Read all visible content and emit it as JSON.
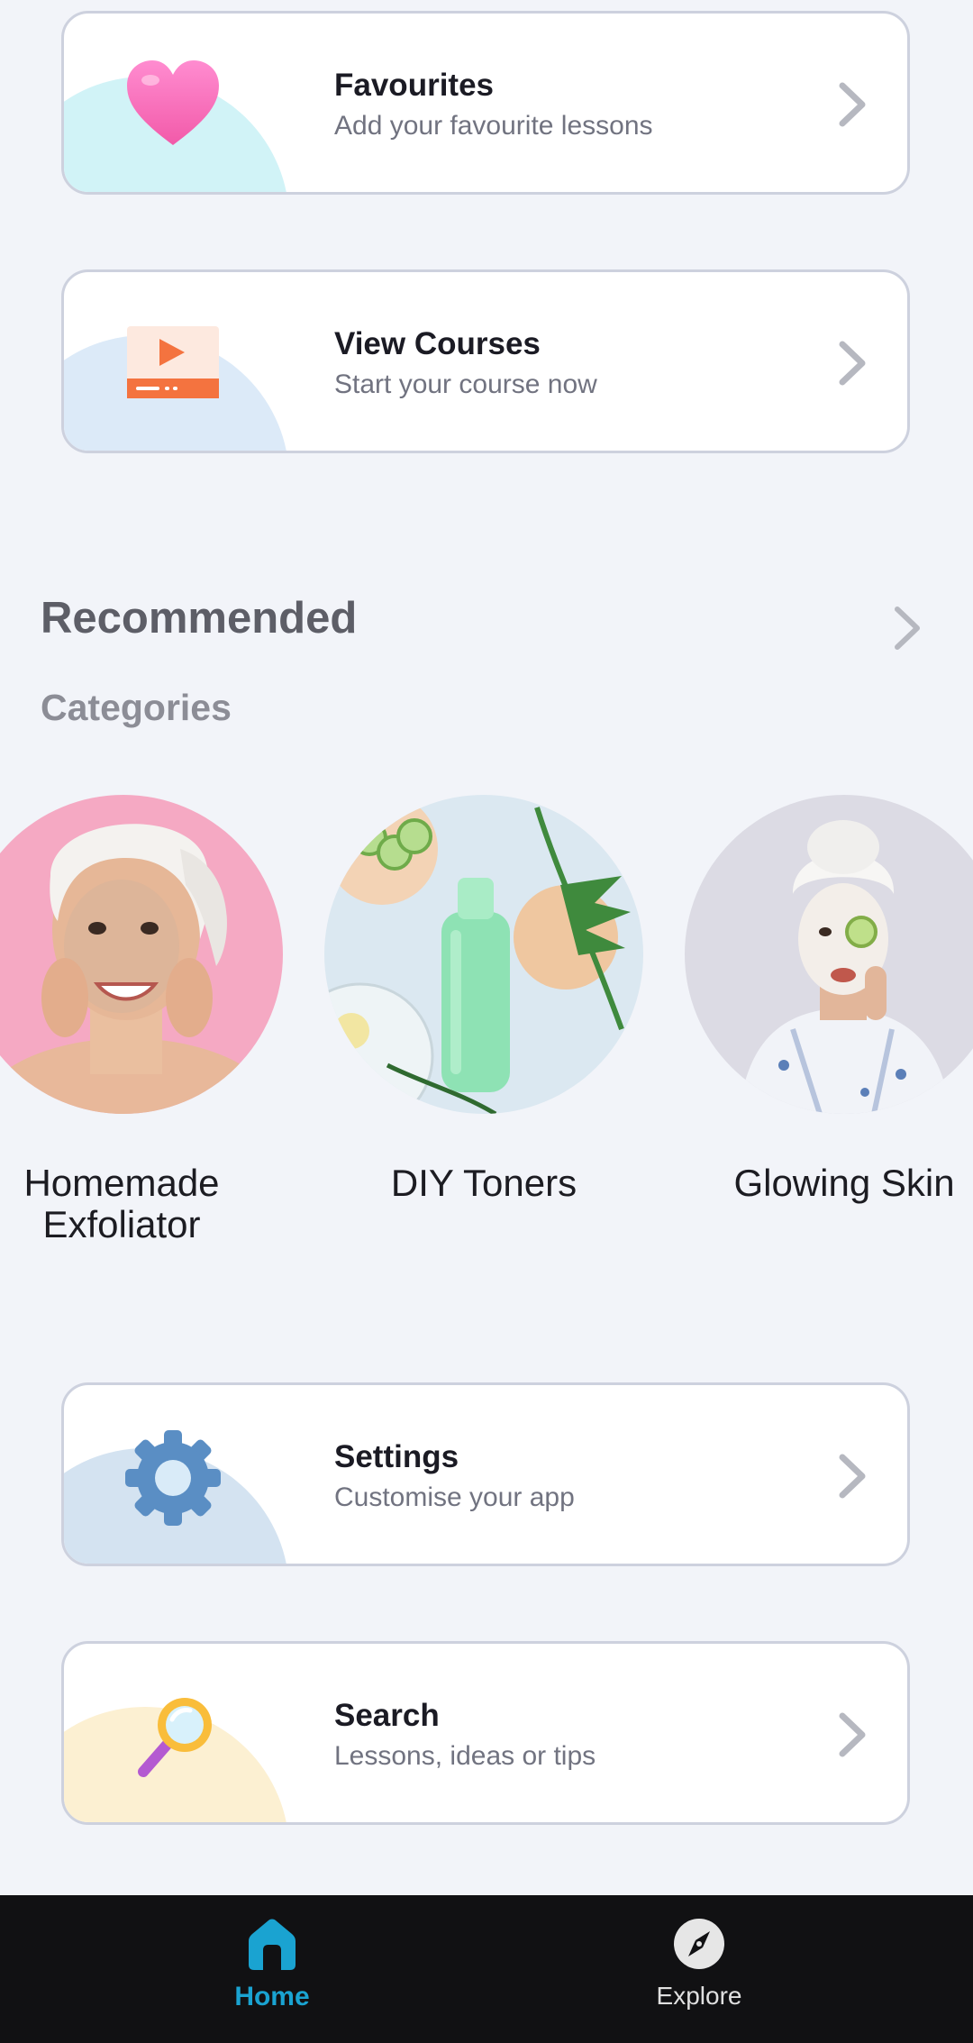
{
  "cards": [
    {
      "title": "Favourites",
      "subtitle": "Add your favourite lessons",
      "icon": "heart-icon",
      "blob_color": "#cdf2f6"
    },
    {
      "title": "View Courses",
      "subtitle": "Start your course now",
      "icon": "video-player-icon",
      "blob_color": "#dbeaf8"
    },
    {
      "title": "Settings",
      "subtitle": "Customise your app",
      "icon": "gear-icon",
      "blob_color": "#d6e4f2"
    },
    {
      "title": "Search",
      "subtitle": "Lessons, ideas or tips",
      "icon": "magnifier-icon",
      "blob_color": "#fdf0cf"
    }
  ],
  "recommended": {
    "title": "Recommended",
    "subtitle": "Categories"
  },
  "categories": [
    {
      "label": "Homemade Exfoliator"
    },
    {
      "label": "DIY Toners"
    },
    {
      "label": "Glowing Skin"
    }
  ],
  "nav": {
    "home_label": "Home",
    "explore_label": "Explore",
    "active_color": "#1aa3d1"
  }
}
